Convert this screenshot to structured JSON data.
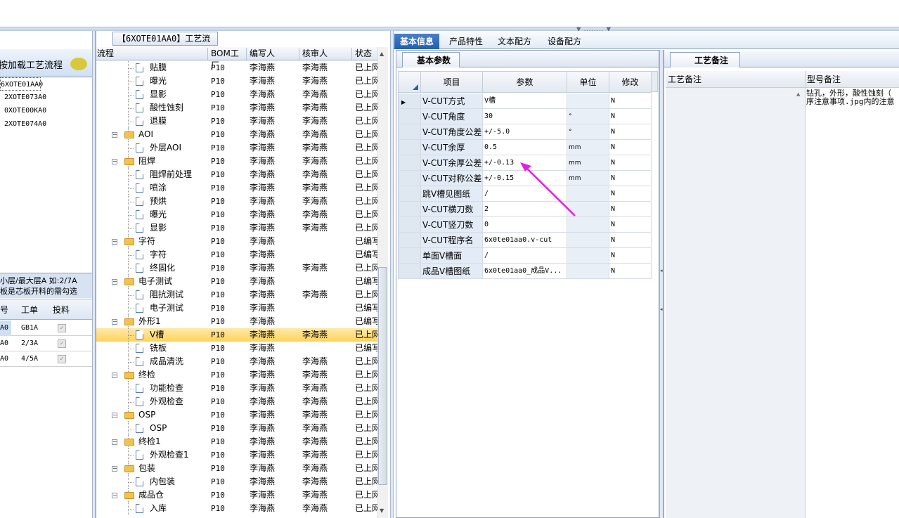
{
  "left": {
    "header": "按加载工艺流程",
    "items": [
      "6XOTE01AA0",
      "2XOTE073A0",
      "0XOTE00KA0",
      "2XOTE074A0"
    ],
    "note_line1": "小层/最大层A 如:2/7A",
    "note_line2": "板是芯板开料的需勾选",
    "table_headers": [
      "号",
      "工单",
      "投料"
    ],
    "table_rows": [
      {
        "c0": "A0",
        "c1": "GB1A",
        "checked": true
      },
      {
        "c0": "A0",
        "c1": "2/3A",
        "checked": true
      },
      {
        "c0": "A0",
        "c1": "4/5A",
        "checked": true
      }
    ]
  },
  "middle": {
    "title_code": "【6XOTE01AA0】",
    "title_text": "工艺流程",
    "headers": [
      "流程",
      "BOM工厂",
      "编写人",
      "核审人",
      "状态"
    ],
    "rows": [
      {
        "type": "leaf",
        "name": "贴膜",
        "bom": "P10",
        "writer": "李海燕",
        "reviewer": "李海燕",
        "status": "已上网"
      },
      {
        "type": "leaf",
        "name": "曝光",
        "bom": "P10",
        "writer": "李海燕",
        "reviewer": "李海燕",
        "status": "已上网"
      },
      {
        "type": "leaf",
        "name": "显影",
        "bom": "P10",
        "writer": "李海燕",
        "reviewer": "李海燕",
        "status": "已上网"
      },
      {
        "type": "leaf",
        "name": "酸性蚀刻",
        "bom": "P10",
        "writer": "李海燕",
        "reviewer": "李海燕",
        "status": "已上网"
      },
      {
        "type": "leaf",
        "name": "退膜",
        "bom": "P10",
        "writer": "李海燕",
        "reviewer": "李海燕",
        "status": "已上网"
      },
      {
        "type": "folder",
        "name": "AOI",
        "bom": "P10",
        "writer": "李海燕",
        "reviewer": "李海燕",
        "status": "已上网"
      },
      {
        "type": "leaf",
        "name": "外层AOI",
        "bom": "P10",
        "writer": "李海燕",
        "reviewer": "李海燕",
        "status": "已上网"
      },
      {
        "type": "folder",
        "name": "阻焊",
        "bom": "P10",
        "writer": "李海燕",
        "reviewer": "李海燕",
        "status": "已上网"
      },
      {
        "type": "leaf",
        "name": "阻焊前处理",
        "bom": "P10",
        "writer": "李海燕",
        "reviewer": "李海燕",
        "status": "已上网"
      },
      {
        "type": "leaf",
        "name": "喷涂",
        "bom": "P10",
        "writer": "李海燕",
        "reviewer": "李海燕",
        "status": "已上网"
      },
      {
        "type": "leaf",
        "name": "预烘",
        "bom": "P10",
        "writer": "李海燕",
        "reviewer": "李海燕",
        "status": "已上网"
      },
      {
        "type": "leaf",
        "name": "曝光",
        "bom": "P10",
        "writer": "李海燕",
        "reviewer": "李海燕",
        "status": "已上网"
      },
      {
        "type": "leaf",
        "name": "显影",
        "bom": "P10",
        "writer": "李海燕",
        "reviewer": "李海燕",
        "status": "已上网"
      },
      {
        "type": "folder",
        "name": "字符",
        "bom": "P10",
        "writer": "李海燕",
        "reviewer": "",
        "status": "已编写"
      },
      {
        "type": "leaf",
        "name": "字符",
        "bom": "P10",
        "writer": "李海燕",
        "reviewer": "",
        "status": "已编写"
      },
      {
        "type": "leaf",
        "name": "终固化",
        "bom": "P10",
        "writer": "李海燕",
        "reviewer": "李海燕",
        "status": "已上网"
      },
      {
        "type": "folder",
        "name": "电子测试",
        "bom": "P10",
        "writer": "李海燕",
        "reviewer": "",
        "status": "已编写"
      },
      {
        "type": "leaf",
        "name": "阻抗测试",
        "bom": "P10",
        "writer": "李海燕",
        "reviewer": "李海燕",
        "status": "已上网"
      },
      {
        "type": "leaf",
        "name": "电子测试",
        "bom": "P10",
        "writer": "李海燕",
        "reviewer": "",
        "status": "已编写"
      },
      {
        "type": "folder",
        "name": "外形1",
        "bom": "P10",
        "writer": "李海燕",
        "reviewer": "",
        "status": "已编写"
      },
      {
        "type": "leaf",
        "name": "V槽",
        "bom": "P10",
        "writer": "李海燕",
        "reviewer": "李海燕",
        "status": "已上网",
        "selected": true
      },
      {
        "type": "leaf",
        "name": "铣板",
        "bom": "P10",
        "writer": "李海燕",
        "reviewer": "",
        "status": "已编写"
      },
      {
        "type": "leaf",
        "name": "成品清洗",
        "bom": "P10",
        "writer": "李海燕",
        "reviewer": "李海燕",
        "status": "已上网"
      },
      {
        "type": "folder",
        "name": "终检",
        "bom": "P10",
        "writer": "李海燕",
        "reviewer": "李海燕",
        "status": "已上网"
      },
      {
        "type": "leaf",
        "name": "功能检查",
        "bom": "P10",
        "writer": "李海燕",
        "reviewer": "李海燕",
        "status": "已上网"
      },
      {
        "type": "leaf",
        "name": "外观检查",
        "bom": "P10",
        "writer": "李海燕",
        "reviewer": "李海燕",
        "status": "已上网"
      },
      {
        "type": "folder",
        "name": "OSP",
        "bom": "P10",
        "writer": "李海燕",
        "reviewer": "李海燕",
        "status": "已上网"
      },
      {
        "type": "leaf",
        "name": "OSP",
        "bom": "P10",
        "writer": "李海燕",
        "reviewer": "李海燕",
        "status": "已上网"
      },
      {
        "type": "folder",
        "name": "终检1",
        "bom": "P10",
        "writer": "李海燕",
        "reviewer": "李海燕",
        "status": "已上网"
      },
      {
        "type": "leaf",
        "name": "外观检查1",
        "bom": "P10",
        "writer": "李海燕",
        "reviewer": "李海燕",
        "status": "已上网"
      },
      {
        "type": "folder",
        "name": "包装",
        "bom": "P10",
        "writer": "李海燕",
        "reviewer": "李海燕",
        "status": "已上网"
      },
      {
        "type": "leaf",
        "name": "内包装",
        "bom": "P10",
        "writer": "李海燕",
        "reviewer": "李海燕",
        "status": "已上网"
      },
      {
        "type": "folder",
        "name": "成品仓",
        "bom": "P10",
        "writer": "李海燕",
        "reviewer": "李海燕",
        "status": "已上网"
      },
      {
        "type": "leaf",
        "name": "入库",
        "bom": "P10",
        "writer": "李海燕",
        "reviewer": "李海燕",
        "status": "已上网"
      }
    ]
  },
  "right": {
    "tabs": [
      "基本信息",
      "产品特性",
      "文本配方",
      "设备配方"
    ],
    "active_tab": 0,
    "subtab": "基本参数",
    "grid_headers": [
      "项目",
      "参数",
      "单位",
      "修改"
    ],
    "grid_rows": [
      {
        "item": "V-CUT方式",
        "param": "V槽",
        "unit": "",
        "mod": "N",
        "current": true
      },
      {
        "item": "V-CUT角度",
        "param": "30",
        "unit": "°",
        "mod": "N"
      },
      {
        "item": "V-CUT角度公差",
        "param": "+/-5.0",
        "unit": "°",
        "mod": "N"
      },
      {
        "item": "V-CUT余厚",
        "param": "0.5",
        "unit": "mm",
        "mod": "N"
      },
      {
        "item": "V-CUT余厚公差",
        "param": "+/-0.13",
        "unit": "mm",
        "mod": "N"
      },
      {
        "item": "V-CUT对称公差",
        "param": "+/-0.15",
        "unit": "mm",
        "mod": "N"
      },
      {
        "item": "跳V槽见图纸",
        "param": "/",
        "unit": "",
        "mod": "N"
      },
      {
        "item": "V-CUT横刀数",
        "param": "2",
        "unit": "",
        "mod": "N"
      },
      {
        "item": "V-CUT竖刀数",
        "param": "0",
        "unit": "",
        "mod": "N"
      },
      {
        "item": "V-CUT程序名",
        "param": "6x0te01aa0.v-cut",
        "unit": "",
        "mod": "N"
      },
      {
        "item": "单面V槽面",
        "param": "/",
        "unit": "",
        "mod": "N"
      },
      {
        "item": "成品V槽图纸",
        "param": "6x0te01aa0_成品V...",
        "unit": "",
        "mod": "N"
      }
    ],
    "remark_tab": "工艺备注",
    "remark_headers": [
      "工艺备注",
      "型号备注"
    ],
    "remark_text_line1": "钻孔，外形，酸性蚀刻（",
    "remark_text_line2": "序注意事项.jpg内的注意",
    "annotation_arrow_color": "#e020e0"
  }
}
